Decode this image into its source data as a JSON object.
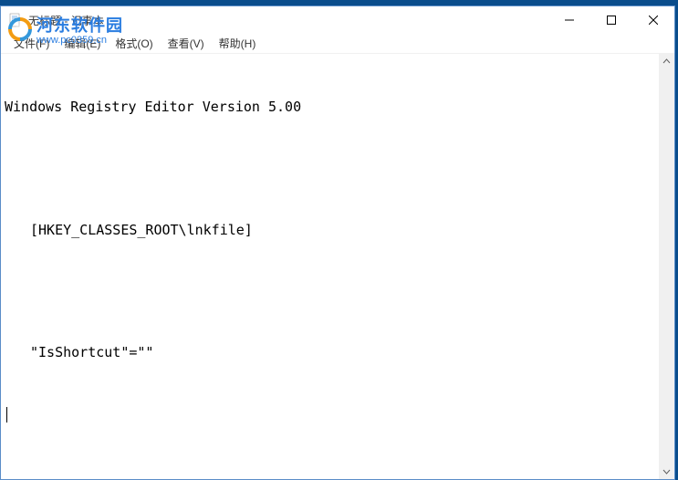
{
  "window": {
    "title": "无标题 - 记事本"
  },
  "menu": {
    "file": "文件(F)",
    "edit": "编辑(E)",
    "format": "格式(O)",
    "view": "查看(V)",
    "help": "帮助(H)"
  },
  "content": {
    "line1": "Windows Registry Editor Version 5.00",
    "line2": "",
    "line3": "[HKEY_CLASSES_ROOT\\lnkfile]",
    "line4": "",
    "line5": "\"IsShortcut\"=\"\""
  },
  "watermark": {
    "cn": "河东软件园",
    "url": "www.pc0359.cn"
  }
}
